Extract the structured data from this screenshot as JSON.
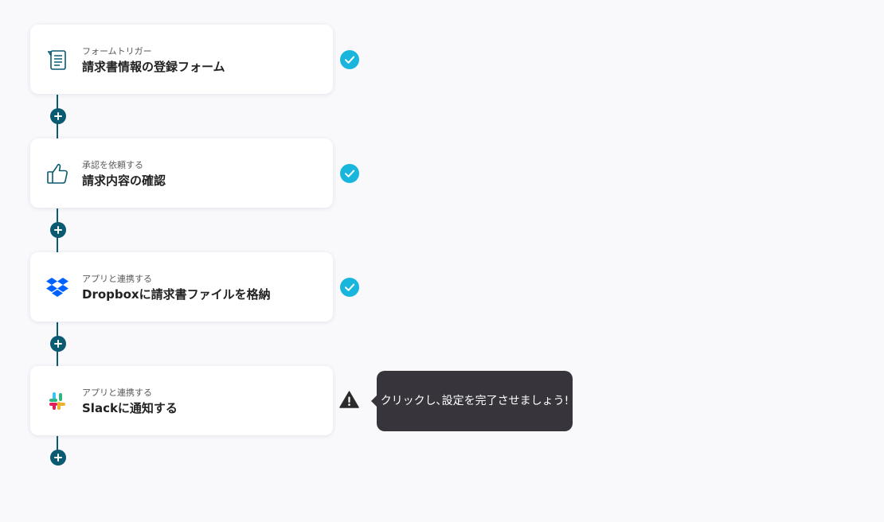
{
  "steps": [
    {
      "subtitle": "フォームトリガー",
      "title": "請求書情報の登録フォーム",
      "icon": "form-icon",
      "status": "complete"
    },
    {
      "subtitle": "承認を依頼する",
      "title": "請求内容の確認",
      "icon": "thumbs-up-icon",
      "status": "complete"
    },
    {
      "subtitle": "アプリと連携する",
      "title": "Dropboxに請求書ファイルを格納",
      "icon": "dropbox-icon",
      "status": "complete"
    },
    {
      "subtitle": "アプリと連携する",
      "title": "Slackに通知する",
      "icon": "slack-icon",
      "status": "incomplete"
    }
  ],
  "tooltip": {
    "text": "クリックし､設定を完了させましょう!"
  },
  "colors": {
    "background": "#f9f8fb",
    "card": "#ffffff",
    "check": "#18b6dc",
    "connector": "#0a5a72",
    "tooltip": "#37353b",
    "dropbox": "#0061fe"
  }
}
